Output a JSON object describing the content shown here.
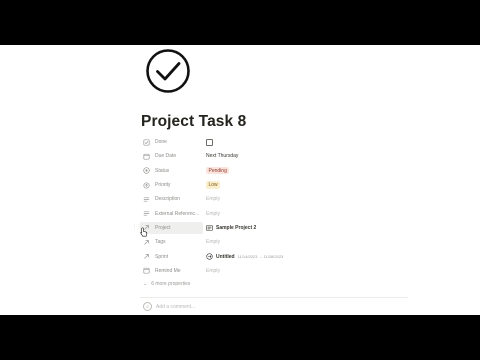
{
  "page": {
    "title": "Project Task 8",
    "icon": "check-circle-icon"
  },
  "properties": [
    {
      "key": "done",
      "icon": "checkbox-icon",
      "name": "Done",
      "type": "checkbox",
      "checked": false
    },
    {
      "key": "due_date",
      "icon": "calendar-icon",
      "name": "Due Date",
      "type": "text",
      "value": "Next Thursday"
    },
    {
      "key": "status",
      "icon": "status-icon",
      "name": "Status",
      "type": "badge",
      "value": "Pending",
      "color": "#fbe4de"
    },
    {
      "key": "priority",
      "icon": "priority-icon",
      "name": "Priority",
      "type": "badge",
      "value": "Low",
      "color": "#fbeecc"
    },
    {
      "key": "description",
      "icon": "text-lines-icon",
      "name": "Description",
      "type": "empty",
      "value": "Empty"
    },
    {
      "key": "external_reference",
      "icon": "text-lines-icon",
      "name": "External Referenc...",
      "type": "empty",
      "value": "Empty"
    },
    {
      "key": "project",
      "icon": "relation-arrow-icon",
      "name": "Project",
      "type": "relation",
      "value": "Sample Project 2"
    },
    {
      "key": "tags",
      "icon": "relation-arrow-icon",
      "name": "Tags",
      "type": "empty",
      "value": "Empty"
    },
    {
      "key": "sprint",
      "icon": "relation-arrow-icon",
      "name": "Sprint",
      "type": "sprint",
      "value": "Untitled",
      "dates": "11/14/2023 → 11/28/2023"
    },
    {
      "key": "remind_me",
      "icon": "calendar-icon",
      "name": "Remind Me",
      "type": "empty",
      "value": "Empty"
    }
  ],
  "more_properties_label": "6 more properties",
  "comment_placeholder": "Add a comment...",
  "colors": {
    "background": "#ffffff",
    "letterbox": "#000000",
    "text": "#37352f",
    "muted": "#9b9a97"
  }
}
